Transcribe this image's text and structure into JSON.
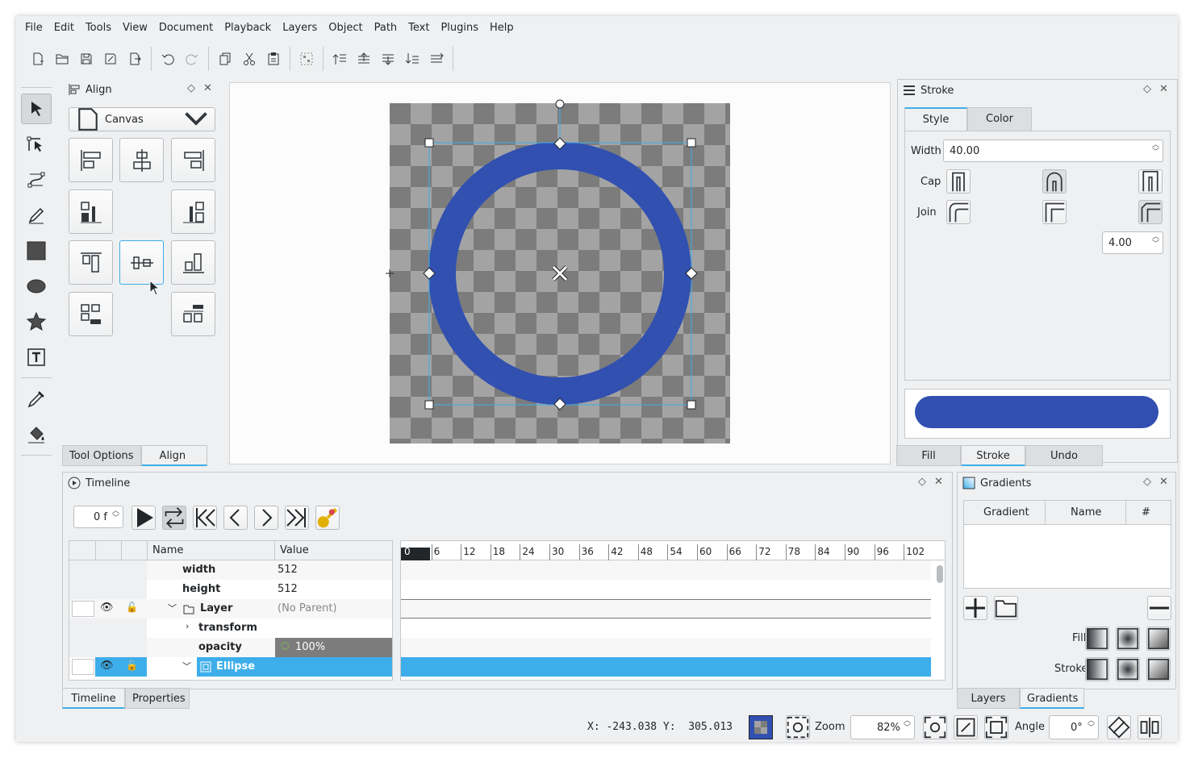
{
  "menu": [
    "File",
    "Edit",
    "Tools",
    "View",
    "Document",
    "Playback",
    "Layers",
    "Object",
    "Path",
    "Text",
    "Plugins",
    "Help"
  ],
  "align_panel": {
    "title": "Align",
    "relative_to": "Canvas"
  },
  "left_tabs": [
    "Tool Options",
    "Align"
  ],
  "stroke_panel": {
    "title": "Stroke",
    "tabs": [
      "Style",
      "Color"
    ],
    "width_label": "Width",
    "width_value": "40.00",
    "cap_label": "Cap",
    "join_label": "Join",
    "miter_value": "4.00",
    "preview_color": "#3150b0"
  },
  "right_tabs": [
    "Fill",
    "Stroke",
    "Undo History"
  ],
  "timeline": {
    "title": "Timeline",
    "frame": "0 f",
    "columns": [
      "Name",
      "Value"
    ],
    "ruler": [
      "0",
      "6",
      "12",
      "18",
      "24",
      "30",
      "36",
      "42",
      "48",
      "54",
      "60",
      "66",
      "72",
      "78",
      "84",
      "90",
      "96",
      "102"
    ],
    "rows": [
      {
        "name": "width",
        "value": "512"
      },
      {
        "name": "height",
        "value": "512"
      },
      {
        "name": "Layer",
        "value": "(No Parent)"
      },
      {
        "name": "transform",
        "value": ""
      },
      {
        "name": "opacity",
        "value": "100%"
      },
      {
        "name": "Ellipse",
        "value": ""
      }
    ]
  },
  "bottom_tabs": [
    "Timeline",
    "Properties"
  ],
  "gradients": {
    "title": "Gradients",
    "columns": [
      "Gradient",
      "Name",
      "#"
    ],
    "fill_label": "Fill",
    "stroke_label": "Stroke"
  },
  "gradient_tabs": [
    "Layers",
    "Gradients"
  ],
  "status": {
    "coords": "X: -243.038 Y:  305.013",
    "zoom_label": "Zoom",
    "zoom_value": "82%",
    "angle_label": "Angle",
    "angle_value": "0°"
  },
  "colors": {
    "accent": "#3daee9",
    "ring": "#3150b0",
    "selection": "#3daee9"
  }
}
